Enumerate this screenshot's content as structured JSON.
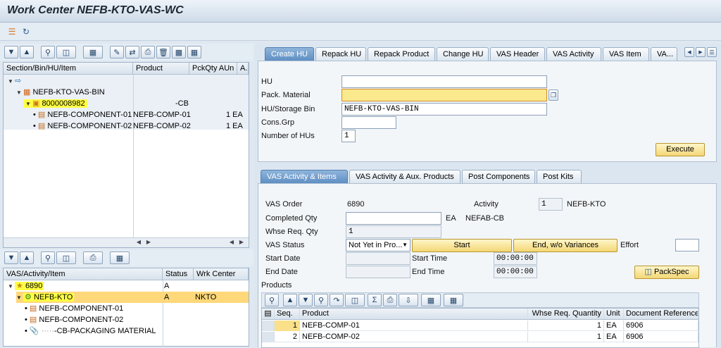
{
  "window": {
    "title": "Work Center NEFB-KTO-VAS-WC"
  },
  "app_toolbar": {
    "icons": [
      "action-log-icon",
      "refresh-icon"
    ]
  },
  "top_tree": {
    "columns": [
      "Section/Bin/HU/Item",
      "Product",
      "PckQty AUn",
      "A."
    ],
    "rows": [
      {
        "label": "",
        "icon": "work-center-icon"
      },
      {
        "label": "NEFB-KTO-VAS-BIN",
        "icon": "storage-bin-icon"
      },
      {
        "label": "8000008982",
        "product": "-CB",
        "icon": "handling-unit-icon"
      },
      {
        "label": "NEFB-COMPONENT-01",
        "product": "NEFB-COMP-01",
        "qty": "1 EA"
      },
      {
        "label": "NEFB-COMPONENT-02",
        "product": "NEFB-COMP-02",
        "qty": "1 EA"
      }
    ]
  },
  "bottom_tree": {
    "columns": [
      "VAS/Activity/Item",
      "Status",
      "Wrk Center"
    ],
    "rows": [
      {
        "label": "6890",
        "status": "A"
      },
      {
        "label": "NEFB-KTO",
        "status": "A",
        "wc": "NKTO"
      },
      {
        "label": "NEFB-COMPONENT-01"
      },
      {
        "label": "NEFB-COMPONENT-02"
      },
      {
        "label": "-CB-PACKAGING MATERIAL"
      }
    ]
  },
  "top_tabs": [
    "Create HU",
    "Repack HU",
    "Repack Product",
    "Change HU",
    "VAS Header",
    "VAS Activity",
    "VAS Item",
    "VA..."
  ],
  "create_hu": {
    "hu_label": "HU",
    "hu_value": "",
    "pack_material_label": "Pack. Material",
    "pack_material_value": "",
    "hu_bin_label": "HU/Storage Bin",
    "hu_bin_value": "NEFB-KTO-VAS-BIN",
    "cons_grp_label": "Cons.Grp",
    "cons_grp_value": "",
    "num_hus_label": "Number of HUs",
    "num_hus_value": "1",
    "execute": "Execute"
  },
  "bottom_tabs": [
    "VAS Activity & Items",
    "VAS Activity & Aux. Products",
    "Post Components",
    "Post Kits"
  ],
  "vas": {
    "order_label": "VAS Order",
    "order_value": "6890",
    "activity_label": "Activity",
    "activity_value": "1",
    "activity_name": "NEFB-KTO",
    "completed_label": "Completed Qty",
    "completed_value": "",
    "completed_unit": "EA",
    "completed_product": "NEFAB-CB",
    "whse_label": "Whse Req. Qty",
    "whse_value": "1",
    "status_label": "VAS Status",
    "status_value": "Not Yet in Pro...",
    "start": "Start",
    "end": "End, w/o Variances",
    "effort_label": "Effort",
    "effort_value": "",
    "start_date_label": "Start Date",
    "start_date_value": "",
    "start_time_label": "Start Time",
    "start_time_value": "00:00:00",
    "end_date_label": "End Date",
    "end_date_value": "",
    "end_time_label": "End Time",
    "end_time_value": "00:00:00",
    "packspec": "PackSpec",
    "products_label": "Products"
  },
  "products": {
    "columns": [
      "Seq.",
      "Product",
      "Whse Req. Quantity",
      "Unit",
      "Document Reference"
    ],
    "rows": [
      {
        "seq": "1",
        "product": "NEFB-COMP-01",
        "qty": "1",
        "unit": "EA",
        "doc": "6906"
      },
      {
        "seq": "2",
        "product": "NEFB-COMP-02",
        "qty": "1",
        "unit": "EA",
        "doc": "6906"
      }
    ]
  }
}
